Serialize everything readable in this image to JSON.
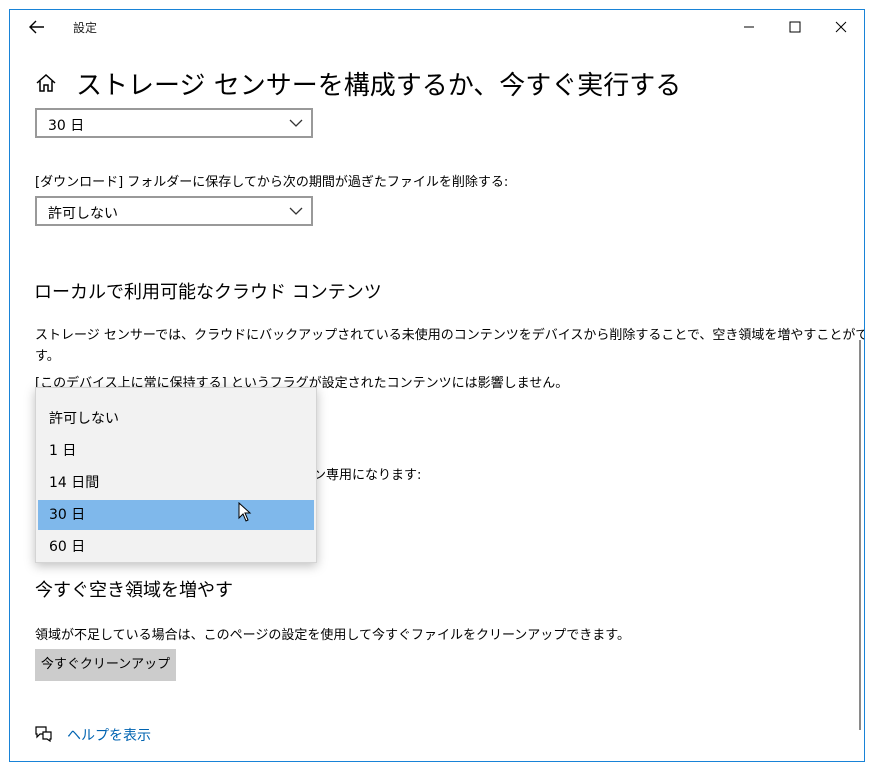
{
  "window": {
    "title": "設定",
    "controls": [
      "minimize",
      "maximize",
      "close"
    ]
  },
  "page": {
    "title": "ストレージ センサーを構成するか、今すぐ実行する"
  },
  "recycle_bin": {
    "selected": "30 日"
  },
  "downloads": {
    "label": "[ダウンロード] フォルダーに保存してから次の期間が過ぎたファイルを削除する:",
    "selected": "許可しない"
  },
  "cloud": {
    "heading": "ローカルで利用可能なクラウド コンテンツ",
    "description_line1": "ストレージ センサーでは、クラウドにバックアップされている未使用のコンテンツをデバイスから削除することで、空き領域を増やすことができま",
    "description_line2": "す。",
    "note": "[このデバイス上に常に保持する] というフラグが設定されたコンテンツには影響しません。",
    "partial_label": "イン専用になります:"
  },
  "dropdown": {
    "options": [
      "許可しない",
      "1 日",
      "14 日間",
      "30 日",
      "60 日"
    ],
    "selected_index": 3
  },
  "free_space": {
    "heading": "今すぐ空き領域を増やす",
    "description": "領域が不足している場合は、このページの設定を使用して今すぐファイルをクリーンアップできます。",
    "button": "今すぐクリーンアップ"
  },
  "help": {
    "link": "ヘルプを表示"
  },
  "colors": {
    "accent_border": "#1883d7",
    "selection": "#7fb8eb",
    "link": "#0063b1"
  }
}
